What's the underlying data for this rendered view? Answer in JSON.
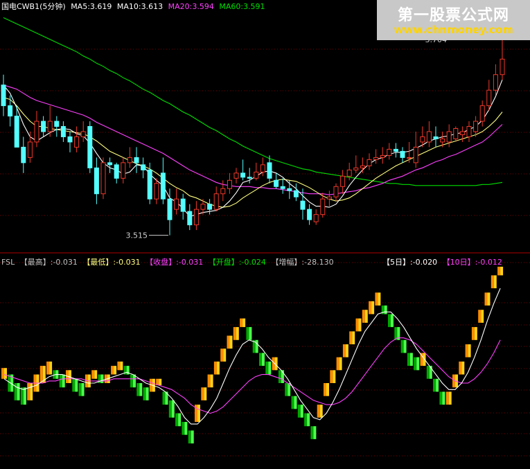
{
  "colors": {
    "up": "#f3392a",
    "down": "#54ffff",
    "ma5": "#ffffff",
    "ma10": "#ffff80",
    "ma20": "#ff40ff",
    "ma60": "#00e000",
    "grid": "#7a0000",
    "label": "#c0c0c0",
    "fsl_up_a": "#ff8c00",
    "fsl_up_b": "#ffd21a",
    "fsl_dn_a": "#00a800",
    "fsl_dn_b": "#4cff4c",
    "fsl_line5": "#ffffff",
    "fsl_line10": "#ff40ff"
  },
  "price_header": {
    "symbol": "国电CWB1(5分钟)",
    "ma5": "MA5:3.619",
    "ma10": "MA10:3.613",
    "ma20": "MA20:3.594",
    "ma60": "MA60:3.591"
  },
  "fsl_header": {
    "name": "FSL",
    "high": "【最高】:-0.031",
    "low": "【最低】:-0.031",
    "close": "【收盘】:-0.031",
    "open": "【开盘】:-0.024",
    "amp": "【增幅】:-28.130",
    "d5": "【5日】:-0.020",
    "d10": "【10日】:-0.012"
  },
  "watermark": {
    "line1": "第一股票公式网",
    "line2": "www.chnmoney.com"
  },
  "chart_data": [
    {
      "type": "candlestick",
      "ylim": [
        3.5,
        3.73
      ],
      "annotations": [
        {
          "text": "3.704",
          "at_index": 70,
          "value": 3.704
        },
        {
          "text": "3.515",
          "at_index": 25,
          "value": 3.515
        }
      ],
      "candles": [
        [
          3.66,
          3.64,
          3.67,
          3.63
        ],
        [
          3.64,
          3.63,
          3.65,
          3.62
        ],
        [
          3.63,
          3.6,
          3.64,
          3.6
        ],
        [
          3.6,
          3.585,
          3.61,
          3.575
        ],
        [
          3.59,
          3.605,
          3.615,
          3.585
        ],
        [
          3.605,
          3.625,
          3.635,
          3.6
        ],
        [
          3.625,
          3.615,
          3.63,
          3.61
        ],
        [
          3.615,
          3.625,
          3.64,
          3.61
        ],
        [
          3.625,
          3.62,
          3.63,
          3.61
        ],
        [
          3.62,
          3.61,
          3.625,
          3.605
        ],
        [
          3.61,
          3.605,
          3.615,
          3.595
        ],
        [
          3.6,
          3.61,
          3.62,
          3.595
        ],
        [
          3.61,
          3.615,
          3.625,
          3.605
        ],
        [
          3.62,
          3.58,
          3.625,
          3.575
        ],
        [
          3.58,
          3.555,
          3.59,
          3.545
        ],
        [
          3.555,
          3.585,
          3.59,
          3.55
        ],
        [
          3.585,
          3.583,
          3.59,
          3.575
        ],
        [
          3.583,
          3.57,
          3.585,
          3.565
        ],
        [
          3.57,
          3.585,
          3.59,
          3.565
        ],
        [
          3.585,
          3.59,
          3.6,
          3.58
        ],
        [
          3.59,
          3.585,
          3.6,
          3.575
        ],
        [
          3.583,
          3.578,
          3.59,
          3.57
        ],
        [
          3.578,
          3.55,
          3.585,
          3.545
        ],
        [
          3.55,
          3.565,
          3.57,
          3.545
        ],
        [
          3.575,
          3.55,
          3.59,
          3.545
        ],
        [
          3.55,
          3.53,
          3.56,
          3.515
        ],
        [
          3.54,
          3.55,
          3.56,
          3.535
        ],
        [
          3.55,
          3.538,
          3.555,
          3.53
        ],
        [
          3.538,
          3.525,
          3.545,
          3.52
        ],
        [
          3.525,
          3.54,
          3.548,
          3.52
        ],
        [
          3.54,
          3.545,
          3.55,
          3.535
        ],
        [
          3.545,
          3.54,
          3.55,
          3.535
        ],
        [
          3.54,
          3.555,
          3.562,
          3.538
        ],
        [
          3.555,
          3.56,
          3.568,
          3.548
        ],
        [
          3.56,
          3.568,
          3.575,
          3.555
        ],
        [
          3.57,
          3.575,
          3.58,
          3.565
        ],
        [
          3.575,
          3.571,
          3.588,
          3.568
        ],
        [
          3.571,
          3.57,
          3.58,
          3.565
        ],
        [
          3.57,
          3.576,
          3.585,
          3.568
        ],
        [
          3.576,
          3.583,
          3.59,
          3.572
        ],
        [
          3.585,
          3.57,
          3.592,
          3.565
        ],
        [
          3.568,
          3.562,
          3.575,
          3.56
        ],
        [
          3.562,
          3.56,
          3.57,
          3.555
        ],
        [
          3.56,
          3.558,
          3.568,
          3.55
        ],
        [
          3.558,
          3.552,
          3.565,
          3.548
        ],
        [
          3.548,
          3.54,
          3.56,
          3.53
        ],
        [
          3.54,
          3.53,
          3.545,
          3.525
        ],
        [
          3.528,
          3.535,
          3.54,
          3.525
        ],
        [
          3.535,
          3.55,
          3.556,
          3.532
        ],
        [
          3.55,
          3.552,
          3.558,
          3.542
        ],
        [
          3.552,
          3.562,
          3.565,
          3.548
        ],
        [
          3.562,
          3.572,
          3.578,
          3.555
        ],
        [
          3.572,
          3.578,
          3.585,
          3.568
        ],
        [
          3.578,
          3.58,
          3.592,
          3.575
        ],
        [
          3.58,
          3.582,
          3.59,
          3.575
        ],
        [
          3.582,
          3.588,
          3.594,
          3.578
        ],
        [
          3.588,
          3.59,
          3.598,
          3.584
        ],
        [
          3.59,
          3.592,
          3.6,
          3.584
        ],
        [
          3.592,
          3.598,
          3.604,
          3.588
        ],
        [
          3.598,
          3.596,
          3.604,
          3.59
        ],
        [
          3.596,
          3.59,
          3.6,
          3.585
        ],
        [
          3.59,
          3.59,
          3.605,
          3.585
        ],
        [
          3.585,
          3.6,
          3.615,
          3.58
        ],
        [
          3.605,
          3.61,
          3.62,
          3.6
        ],
        [
          3.605,
          3.615,
          3.625,
          3.6
        ],
        [
          3.61,
          3.608,
          3.62,
          3.6
        ],
        [
          3.605,
          3.608,
          3.615,
          3.6
        ],
        [
          3.605,
          3.615,
          3.622,
          3.6
        ],
        [
          3.608,
          3.618,
          3.62,
          3.605
        ],
        [
          3.612,
          3.615,
          3.62,
          3.605
        ],
        [
          3.61,
          3.62,
          3.625,
          3.605
        ],
        [
          3.615,
          3.625,
          3.63,
          3.61
        ],
        [
          3.625,
          3.64,
          3.645,
          3.62
        ],
        [
          3.64,
          3.655,
          3.665,
          3.635
        ],
        [
          3.655,
          3.67,
          3.68,
          3.65
        ],
        [
          3.67,
          3.685,
          3.705,
          3.665
        ]
      ],
      "ma5": [
        3.66,
        3.652,
        3.638,
        3.622,
        3.61,
        3.606,
        3.61,
        3.614,
        3.617,
        3.618,
        3.617,
        3.613,
        3.611,
        3.604,
        3.594,
        3.585,
        3.58,
        3.578,
        3.574,
        3.576,
        3.583,
        3.582,
        3.574,
        3.568,
        3.563,
        3.551,
        3.547,
        3.541,
        3.533,
        3.535,
        3.537,
        3.538,
        3.539,
        3.542,
        3.548,
        3.556,
        3.566,
        3.568,
        3.572,
        3.576,
        3.577,
        3.575,
        3.571,
        3.565,
        3.56,
        3.553,
        3.547,
        3.543,
        3.543,
        3.542,
        3.545,
        3.553,
        3.563,
        3.571,
        3.578,
        3.584,
        3.588,
        3.59,
        3.593,
        3.595,
        3.595,
        3.596,
        3.599,
        3.602,
        3.606,
        3.608,
        3.61,
        3.611,
        3.613,
        3.614,
        3.617,
        3.62,
        3.626,
        3.636,
        3.649,
        3.665
      ],
      "ma10": [
        3.648,
        3.646,
        3.64,
        3.632,
        3.625,
        3.62,
        3.62,
        3.618,
        3.617,
        3.616,
        3.615,
        3.614,
        3.613,
        3.61,
        3.606,
        3.601,
        3.596,
        3.593,
        3.59,
        3.587,
        3.584,
        3.582,
        3.579,
        3.575,
        3.57,
        3.565,
        3.561,
        3.558,
        3.553,
        3.551,
        3.548,
        3.545,
        3.543,
        3.542,
        3.543,
        3.546,
        3.551,
        3.555,
        3.559,
        3.563,
        3.566,
        3.568,
        3.569,
        3.568,
        3.567,
        3.564,
        3.561,
        3.557,
        3.553,
        3.55,
        3.548,
        3.549,
        3.551,
        3.555,
        3.56,
        3.565,
        3.57,
        3.574,
        3.578,
        3.582,
        3.585,
        3.588,
        3.591,
        3.594,
        3.597,
        3.6,
        3.602,
        3.604,
        3.606,
        3.608,
        3.61,
        3.612,
        3.615,
        3.62,
        3.626,
        3.634
      ],
      "ma20": [
        3.66,
        3.658,
        3.656,
        3.652,
        3.648,
        3.645,
        3.643,
        3.641,
        3.639,
        3.637,
        3.635,
        3.633,
        3.631,
        3.628,
        3.624,
        3.621,
        3.618,
        3.615,
        3.612,
        3.609,
        3.606,
        3.603,
        3.6,
        3.597,
        3.594,
        3.59,
        3.586,
        3.582,
        3.578,
        3.575,
        3.572,
        3.569,
        3.566,
        3.564,
        3.563,
        3.562,
        3.562,
        3.562,
        3.561,
        3.561,
        3.56,
        3.56,
        3.559,
        3.558,
        3.557,
        3.556,
        3.555,
        3.555,
        3.555,
        3.554,
        3.555,
        3.556,
        3.557,
        3.558,
        3.56,
        3.561,
        3.563,
        3.565,
        3.568,
        3.57,
        3.572,
        3.575,
        3.578,
        3.58,
        3.583,
        3.586,
        3.588,
        3.591,
        3.593,
        3.596,
        3.599,
        3.602,
        3.605,
        3.61,
        3.616,
        3.622
      ],
      "ma60": [
        3.725,
        3.722,
        3.719,
        3.716,
        3.713,
        3.71,
        3.707,
        3.704,
        3.701,
        3.698,
        3.695,
        3.692,
        3.688,
        3.685,
        3.681,
        3.678,
        3.674,
        3.671,
        3.667,
        3.664,
        3.66,
        3.656,
        3.653,
        3.649,
        3.645,
        3.642,
        3.638,
        3.634,
        3.631,
        3.627,
        3.623,
        3.619,
        3.616,
        3.612,
        3.608,
        3.605,
        3.601,
        3.598,
        3.595,
        3.592,
        3.589,
        3.587,
        3.585,
        3.583,
        3.581,
        3.579,
        3.578,
        3.576,
        3.575,
        3.574,
        3.573,
        3.572,
        3.571,
        3.57,
        3.569,
        3.568,
        3.567,
        3.566,
        3.565,
        3.565,
        3.564,
        3.564,
        3.563,
        3.563,
        3.563,
        3.563,
        3.563,
        3.563,
        3.563,
        3.563,
        3.563,
        3.563,
        3.564,
        3.564,
        3.565,
        3.566
      ]
    },
    {
      "type": "bar",
      "name": "FSL",
      "ylim": [
        -0.06,
        0.03
      ],
      "bars": [
        [
          -0.022,
          -0.017
        ],
        [
          -0.028,
          -0.02
        ],
        [
          -0.032,
          -0.024
        ],
        [
          -0.034,
          -0.026
        ],
        [
          -0.032,
          -0.024
        ],
        [
          -0.028,
          -0.02
        ],
        [
          -0.024,
          -0.016
        ],
        [
          -0.02,
          -0.014
        ],
        [
          -0.022,
          -0.018
        ],
        [
          -0.026,
          -0.02
        ],
        [
          -0.024,
          -0.018
        ],
        [
          -0.028,
          -0.022
        ],
        [
          -0.03,
          -0.024
        ],
        [
          -0.026,
          -0.02
        ],
        [
          -0.022,
          -0.018
        ],
        [
          -0.024,
          -0.02
        ],
        [
          -0.024,
          -0.02
        ],
        [
          -0.02,
          -0.016
        ],
        [
          -0.018,
          -0.014
        ],
        [
          -0.02,
          -0.016
        ],
        [
          -0.026,
          -0.02
        ],
        [
          -0.03,
          -0.024
        ],
        [
          -0.032,
          -0.026
        ],
        [
          -0.028,
          -0.022
        ],
        [
          -0.025,
          -0.022
        ],
        [
          -0.034,
          -0.028
        ],
        [
          -0.04,
          -0.032
        ],
        [
          -0.044,
          -0.038
        ],
        [
          -0.048,
          -0.042
        ],
        [
          -0.052,
          -0.046
        ],
        [
          -0.042,
          -0.034
        ],
        [
          -0.032,
          -0.026
        ],
        [
          -0.026,
          -0.02
        ],
        [
          -0.02,
          -0.014
        ],
        [
          -0.014,
          -0.008
        ],
        [
          -0.008,
          -0.002
        ],
        [
          -0.004,
          0.002
        ],
        [
          0.002,
          0.006
        ],
        [
          -0.004,
          0.002
        ],
        [
          -0.01,
          -0.004
        ],
        [
          -0.016,
          -0.01
        ],
        [
          -0.02,
          -0.014
        ],
        [
          -0.018,
          -0.012
        ],
        [
          -0.024,
          -0.018
        ],
        [
          -0.03,
          -0.024
        ],
        [
          -0.036,
          -0.03
        ],
        [
          -0.04,
          -0.034
        ],
        [
          -0.044,
          -0.038
        ],
        [
          -0.05,
          -0.044
        ],
        [
          -0.04,
          -0.034
        ],
        [
          -0.03,
          -0.024
        ],
        [
          -0.024,
          -0.018
        ],
        [
          -0.018,
          -0.012
        ],
        [
          -0.012,
          -0.006
        ],
        [
          -0.006,
          0.0
        ],
        [
          0.0,
          0.006
        ],
        [
          0.004,
          0.01
        ],
        [
          0.008,
          0.014
        ],
        [
          0.012,
          0.018
        ],
        [
          0.008,
          0.012
        ],
        [
          0.002,
          0.008
        ],
        [
          -0.004,
          0.002
        ],
        [
          -0.01,
          -0.004
        ],
        [
          -0.016,
          -0.01
        ],
        [
          -0.018,
          -0.012
        ],
        [
          -0.016,
          -0.01
        ],
        [
          -0.022,
          -0.016
        ],
        [
          -0.028,
          -0.022
        ],
        [
          -0.034,
          -0.028
        ],
        [
          -0.034,
          -0.028
        ],
        [
          -0.026,
          -0.02
        ],
        [
          -0.02,
          -0.014
        ],
        [
          -0.012,
          -0.006
        ],
        [
          -0.004,
          0.002
        ],
        [
          0.004,
          0.01
        ],
        [
          0.012,
          0.018
        ],
        [
          0.02,
          0.026
        ],
        [
          0.026,
          0.03
        ]
      ],
      "line5": [
        -0.022,
        -0.024,
        -0.026,
        -0.027,
        -0.026,
        -0.025,
        -0.023,
        -0.021,
        -0.02,
        -0.02,
        -0.021,
        -0.022,
        -0.023,
        -0.024,
        -0.024,
        -0.023,
        -0.022,
        -0.021,
        -0.02,
        -0.019,
        -0.02,
        -0.022,
        -0.024,
        -0.025,
        -0.026,
        -0.028,
        -0.031,
        -0.035,
        -0.04,
        -0.043,
        -0.043,
        -0.04,
        -0.036,
        -0.031,
        -0.024,
        -0.017,
        -0.011,
        -0.006,
        -0.004,
        -0.005,
        -0.008,
        -0.012,
        -0.015,
        -0.018,
        -0.022,
        -0.027,
        -0.032,
        -0.036,
        -0.04,
        -0.041,
        -0.038,
        -0.033,
        -0.027,
        -0.02,
        -0.013,
        -0.006,
        0.0,
        0.004,
        0.008,
        0.009,
        0.009,
        0.006,
        0.002,
        -0.003,
        -0.008,
        -0.012,
        -0.016,
        -0.02,
        -0.024,
        -0.027,
        -0.027,
        -0.024,
        -0.019,
        -0.012,
        -0.004,
        0.005,
        0.013,
        0.02
      ],
      "line10": [
        -0.02,
        -0.021,
        -0.022,
        -0.023,
        -0.024,
        -0.024,
        -0.024,
        -0.023,
        -0.023,
        -0.022,
        -0.022,
        -0.022,
        -0.022,
        -0.023,
        -0.023,
        -0.023,
        -0.023,
        -0.022,
        -0.022,
        -0.022,
        -0.022,
        -0.022,
        -0.023,
        -0.024,
        -0.025,
        -0.026,
        -0.027,
        -0.029,
        -0.031,
        -0.034,
        -0.036,
        -0.037,
        -0.038,
        -0.037,
        -0.035,
        -0.032,
        -0.029,
        -0.026,
        -0.023,
        -0.021,
        -0.02,
        -0.02,
        -0.021,
        -0.022,
        -0.024,
        -0.026,
        -0.028,
        -0.03,
        -0.032,
        -0.033,
        -0.034,
        -0.034,
        -0.033,
        -0.031,
        -0.028,
        -0.024,
        -0.02,
        -0.016,
        -0.012,
        -0.008,
        -0.005,
        -0.003,
        -0.003,
        -0.004,
        -0.006,
        -0.009,
        -0.012,
        -0.015,
        -0.018,
        -0.021,
        -0.023,
        -0.024,
        -0.024,
        -0.022,
        -0.019,
        -0.015,
        -0.01,
        -0.004
      ]
    }
  ]
}
